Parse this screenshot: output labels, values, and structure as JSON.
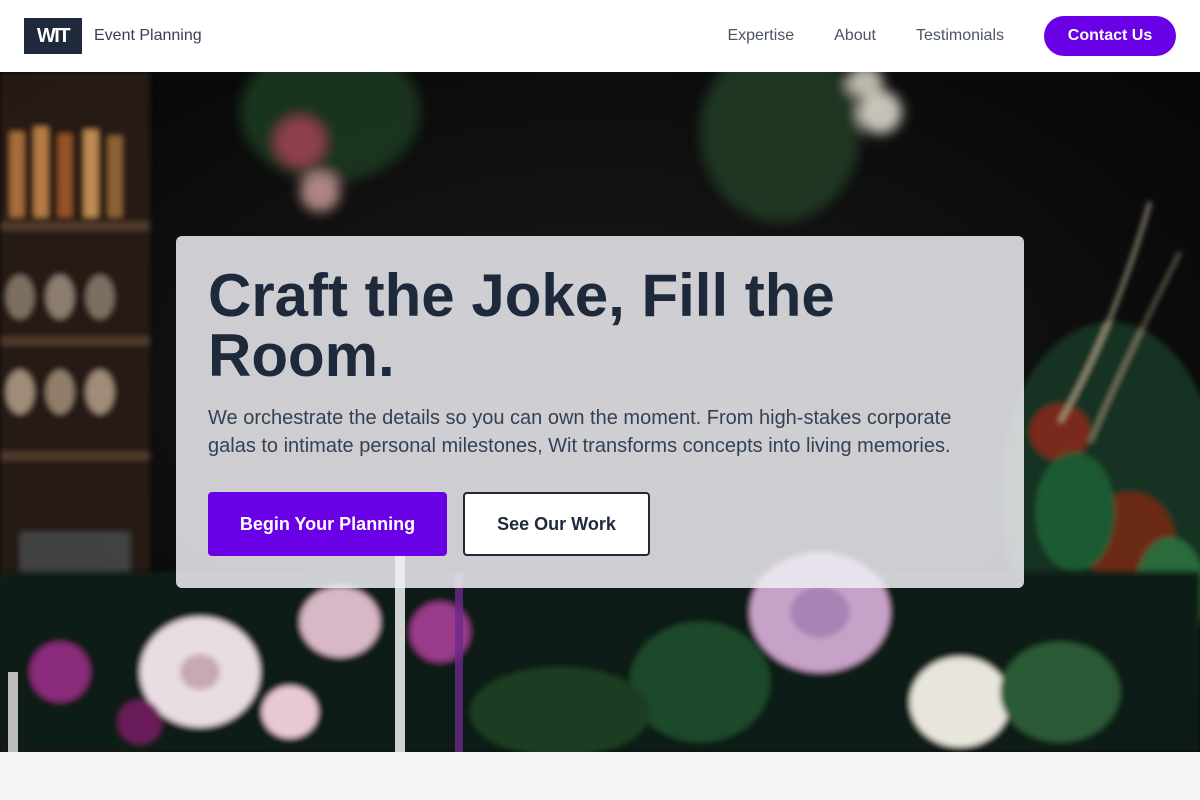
{
  "brand": {
    "logo_text": "WIT",
    "name": "Event Planning"
  },
  "nav": {
    "items": [
      "Expertise",
      "About",
      "Testimonials"
    ],
    "cta": "Contact Us"
  },
  "hero": {
    "title": "Craft the Joke, Fill the Room.",
    "subtitle": "We orchestrate the details so you can own the moment. From high-stakes corporate galas to intimate personal milestones, Wit transforms concepts into living memories.",
    "primary_button": "Begin Your Planning",
    "secondary_button": "See Our Work",
    "background": "floral-arrangement-photo"
  },
  "colors": {
    "accent": "#6a00e6",
    "dark": "#1e293b",
    "header_bg": "#ffffff"
  }
}
